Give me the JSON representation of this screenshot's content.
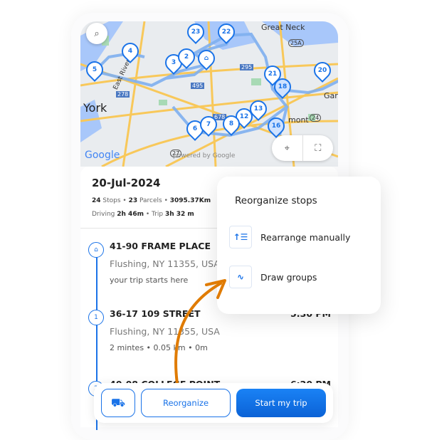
{
  "map": {
    "labels": {
      "great_neck": "Great Neck",
      "york": "York",
      "east_river": "East River",
      "belmont": "mont",
      "gar": "Gar",
      "provider": "Google",
      "powered_by": "powered by Google"
    },
    "highways": [
      "278",
      "495",
      "295",
      "678",
      "25A",
      "24",
      "27"
    ],
    "pins": [
      "23",
      "22",
      "4",
      "5",
      "3",
      "2",
      "21",
      "18",
      "20",
      "13",
      "12",
      "6",
      "7",
      "8",
      "16"
    ],
    "selected_pins": [
      "18",
      "16"
    ],
    "icons": {
      "search": "search-icon",
      "home": "home-icon",
      "locate": "crosshair-icon",
      "fullscreen": "fullscreen-icon"
    }
  },
  "summary": {
    "date": "20-Jul-2024",
    "stops_count": "24",
    "stops_label": "Stops",
    "parcels_count": "23",
    "parcels_label": "Parcels",
    "distance": "3095.37Km",
    "driving_label": "Driving",
    "driving": "2h 46m",
    "trip_label": "Trip",
    "trip": "3h 32 m"
  },
  "stops": [
    {
      "marker": "home",
      "title": "41-90 FRAME PLACE",
      "address": "Flushing, NY 11355, USA",
      "note": "your trip starts here",
      "time": ""
    },
    {
      "marker": "1",
      "title": "36-17 109 STREET",
      "address": "Flushing, NY 11355, USA",
      "note": "2 mintes  • 0.05 km • 0m",
      "time": "5:30 PM"
    },
    {
      "marker": "2",
      "title": "40-08 COLLEGE POINT",
      "address": "",
      "note": "",
      "time": "6:20 PM"
    }
  ],
  "popup": {
    "title": "Reorganize stops",
    "options": [
      {
        "label": "Rearrange manually",
        "icon": "sort-ascending-icon"
      },
      {
        "label": "Draw groups",
        "icon": "draw-squiggle-icon"
      }
    ]
  },
  "actions": {
    "reorganize": "Reorganize",
    "start": "Start my trip",
    "loader_icon": "hand-truck-icon"
  },
  "colors": {
    "accent": "#1a73e8",
    "annotation_arrow": "#e07b00"
  }
}
